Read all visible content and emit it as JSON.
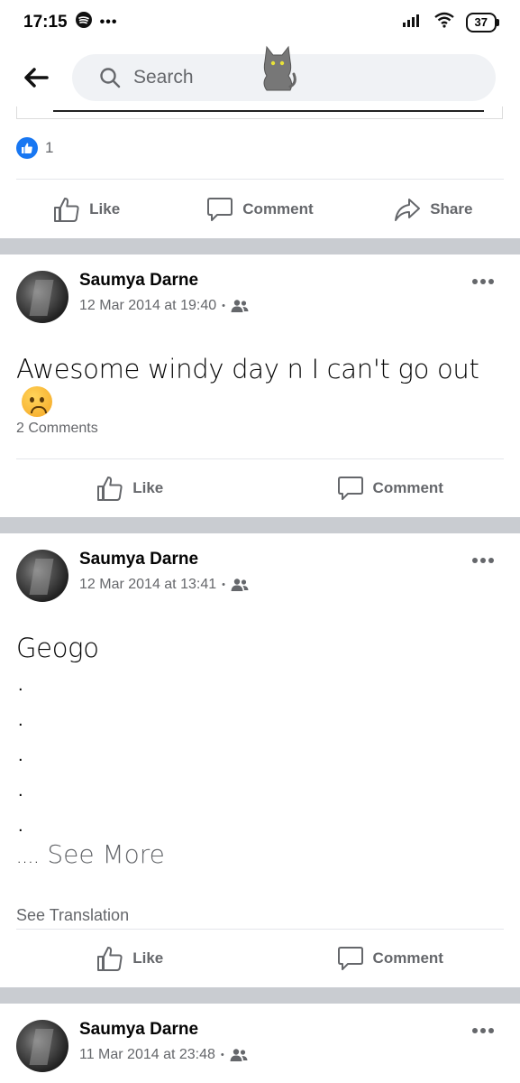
{
  "status_bar": {
    "time": "17:15",
    "more": "•••",
    "battery": "37"
  },
  "search": {
    "placeholder": "Search"
  },
  "prev_post": {
    "reaction_count": "1",
    "actions": {
      "like": "Like",
      "comment": "Comment",
      "share": "Share"
    }
  },
  "posts": [
    {
      "author": "Saumya Darne",
      "date": "12 Mar 2014 at 19:40",
      "sep": "•",
      "text": "Awesome windy day n I can't go out",
      "comments": "2 Comments",
      "actions": {
        "like": "Like",
        "comment": "Comment"
      }
    },
    {
      "author": "Saumya Darne",
      "date": "12 Mar 2014 at 13:41",
      "sep": "•",
      "text": "Geogo",
      "dots": [
        ".",
        ".",
        ".",
        ".",
        "."
      ],
      "ellipsis": "....",
      "see_more": "See More",
      "see_translation": "See Translation",
      "actions": {
        "like": "Like",
        "comment": "Comment"
      }
    },
    {
      "author": "Saumya Darne",
      "date": "11 Mar 2014 at 23:48",
      "sep": "•"
    }
  ],
  "colors": {
    "accent": "#1877f2",
    "separator": "#c9ccd1",
    "secondary_text": "#65676b"
  }
}
